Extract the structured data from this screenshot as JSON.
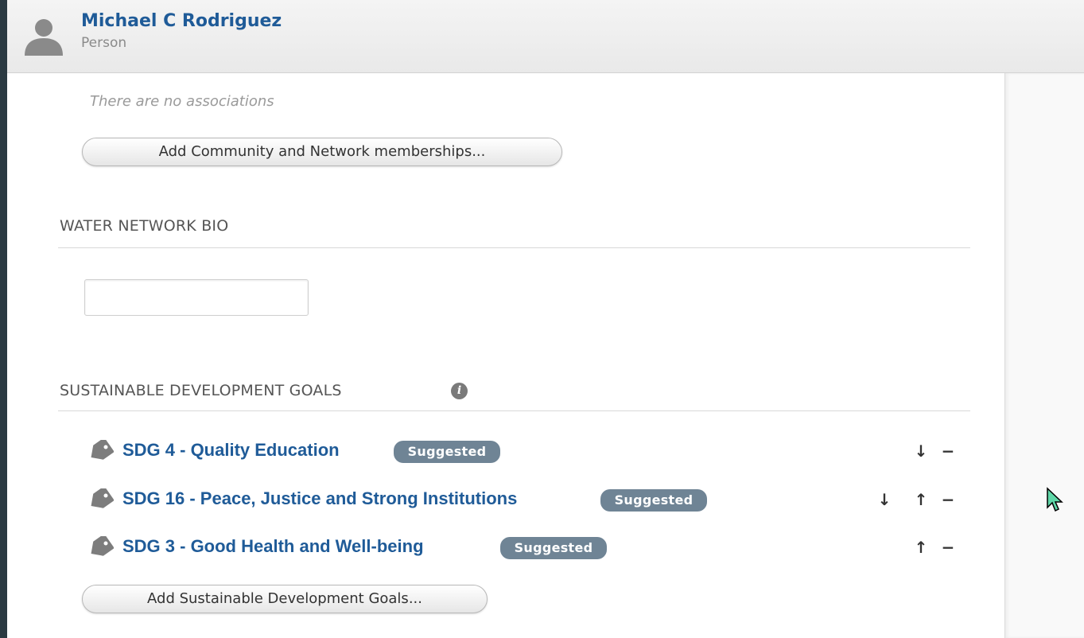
{
  "header": {
    "name": "Michael C Rodriguez",
    "type": "Person",
    "avatar_icon": "person-icon"
  },
  "associations": {
    "empty_text": "There are no associations",
    "add_button_label": "Add Community and Network memberships..."
  },
  "water_network_bio": {
    "title": "WATER NETWORK BIO",
    "input_value": ""
  },
  "sdg": {
    "title": "SUSTAINABLE DEVELOPMENT GOALS",
    "info_icon": "info-icon",
    "items": [
      {
        "label": "SDG 4 - Quality Education",
        "badge": "Suggested",
        "controls": [
          "move-down",
          "remove"
        ]
      },
      {
        "label": "SDG 16 - Peace, Justice and Strong Institutions",
        "badge": "Suggested",
        "controls": [
          "move-down",
          "move-up",
          "remove"
        ]
      },
      {
        "label": "SDG 3 - Good Health and Well-being",
        "badge": "Suggested",
        "controls": [
          "move-up",
          "remove"
        ]
      }
    ],
    "add_button_label": "Add Sustainable Development Goals..."
  },
  "colors": {
    "link": "#1f5b98",
    "badge": "#6f8495",
    "background": "#2b3a42"
  }
}
